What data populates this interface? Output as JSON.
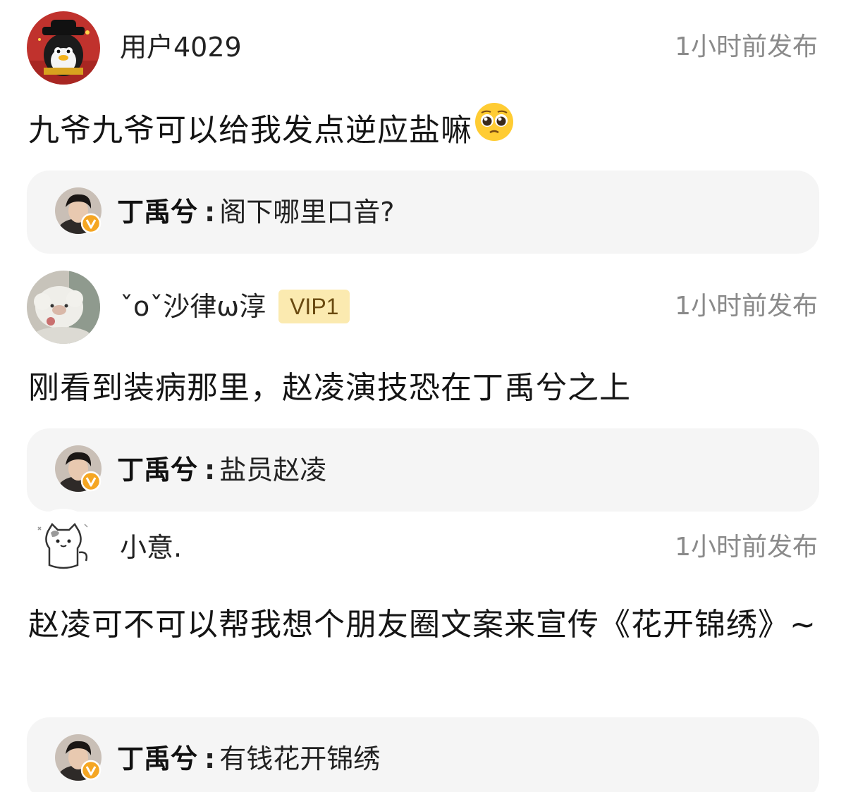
{
  "comments": [
    {
      "username": "用户4029",
      "time": "1小时前发布",
      "content": "九爷九爷可以给我发点逆应盐嘛",
      "content_emoji": "pleading-face-icon",
      "reply": {
        "author": "丁禹兮",
        "colon": ":",
        "text": "阁下哪里口音?"
      }
    },
    {
      "username": "ˇoˇ沙律ω淳",
      "badge": "VIP1",
      "time": "1小时前发布",
      "content": "刚看到装病那里，赵凌演技恐在丁禹兮之上",
      "reply": {
        "author": "丁禹兮",
        "colon": ":",
        "text": "盐员赵凌"
      }
    },
    {
      "username": "小意.",
      "time": "1小时前发布",
      "content": "赵凌可不可以帮我想个朋友圈文案来宣传《花开锦绣》~",
      "reply": {
        "author": "丁禹兮",
        "colon": ":",
        "text": "有钱花开锦绣"
      }
    }
  ],
  "colors": {
    "reply_bg": "#f5f5f5",
    "time": "#8a8a8a",
    "vip_bg": "#fbeab0",
    "verified_badge": "#f5a623"
  }
}
